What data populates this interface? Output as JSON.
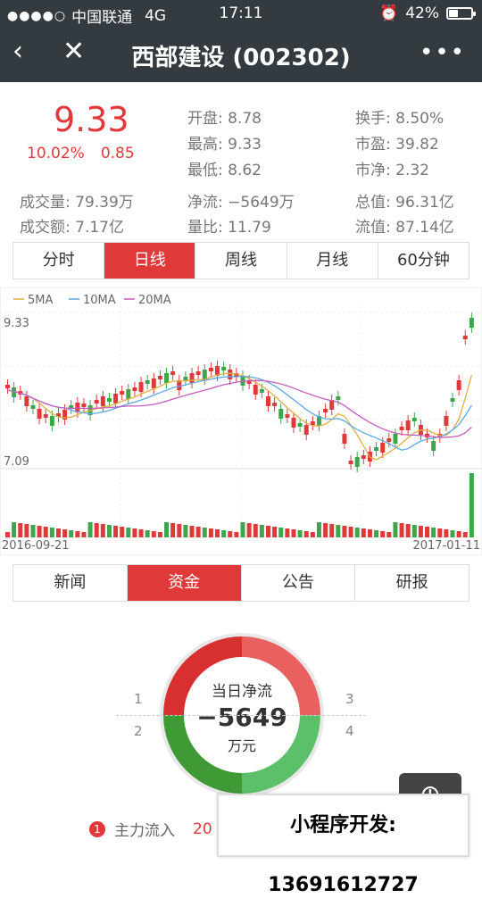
{
  "status": {
    "carrier": "中国联通",
    "network": "4G",
    "time": "17:11",
    "battery": "42%",
    "battery_level": 0.42
  },
  "nav": {
    "title": "西部建设 (002302)"
  },
  "quote": {
    "price": "9.33",
    "change_pct": "10.02%",
    "change": "0.85",
    "fields": [
      {
        "label": "开盘",
        "value": "8.78"
      },
      {
        "label": "换手",
        "value": "8.50%"
      },
      {
        "label": "最高",
        "value": "9.33"
      },
      {
        "label": "市盈",
        "value": "39.82"
      },
      {
        "label": "最低",
        "value": "8.62"
      },
      {
        "label": "市净",
        "value": "2.32"
      },
      {
        "label": "成交量",
        "value": "79.39万"
      },
      {
        "label": "净流",
        "value": "−5649万"
      },
      {
        "label": "总值",
        "value": "96.31亿"
      },
      {
        "label": "成交额",
        "value": "7.17亿"
      },
      {
        "label": "量比",
        "value": "11.79"
      },
      {
        "label": "流值",
        "value": "87.14亿"
      }
    ]
  },
  "period_tabs": [
    "分时",
    "日线",
    "周线",
    "月线",
    "60分钟"
  ],
  "bottom_tabs": [
    "新闻",
    "资金",
    "公告",
    "研报"
  ],
  "chart_data": {
    "type": "candlestick",
    "legend": [
      "5MA",
      "10MA",
      "20MA"
    ],
    "ma_colors": {
      "ma5": "#e0b040",
      "ma10": "#5aa9e6",
      "ma20": "#c75bbd"
    },
    "y_top_label": "9.33",
    "y_bottom_label": "7.09",
    "x_start": "2016-09-21",
    "x_end": "2017-01-11",
    "ylim": [
      7.09,
      9.33
    ]
  },
  "donut": {
    "title": "当日净流",
    "value": "−5649",
    "unit": "万元",
    "quadrants": [
      "1",
      "2",
      "3",
      "4"
    ]
  },
  "legend_row": {
    "badge": "1",
    "label": "主力流入",
    "value": "20"
  },
  "promo": "小程序开发: 13691612727",
  "colors": {
    "red": "#e0393a",
    "green": "#3fa54a",
    "dark": "#333a40"
  }
}
